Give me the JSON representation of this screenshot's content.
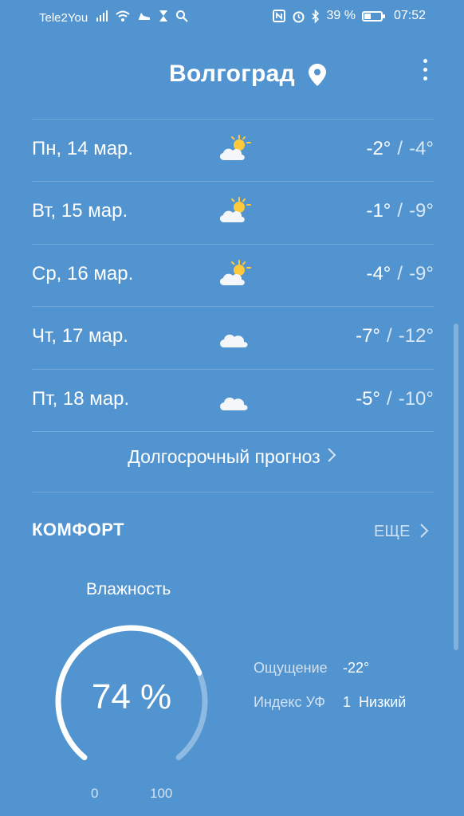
{
  "status_bar": {
    "carrier": "Tele2You",
    "battery": "39 %",
    "battery_level": 0.39,
    "time": "07:52",
    "icons": [
      "signal-icon",
      "wifi-icon",
      "shoe-icon",
      "hourglass-icon",
      "search-icon",
      "nfc-icon",
      "alarm-icon",
      "bluetooth-icon",
      "battery-icon"
    ]
  },
  "header": {
    "city": "Волгоград",
    "location_icon": "location-pin-icon",
    "menu_icon": "more-vert-icon"
  },
  "forecast": [
    {
      "day": "Пн, 14 мар.",
      "icon": "partly-sunny-icon",
      "high": "-2°",
      "low": "-4°"
    },
    {
      "day": "Вт, 15 мар.",
      "icon": "partly-sunny-icon",
      "high": "-1°",
      "low": "-9°"
    },
    {
      "day": "Ср, 16 мар.",
      "icon": "partly-sunny-icon",
      "high": "-4°",
      "low": "-9°"
    },
    {
      "day": "Чт, 17 мар.",
      "icon": "cloud-icon",
      "high": "-7°",
      "low": "-12°"
    },
    {
      "day": "Пт, 18 мар.",
      "icon": "cloud-icon",
      "high": "-5°",
      "low": "-10°"
    }
  ],
  "temp_separator": "/",
  "long_term_label": "Долгосрочный прогноз",
  "comfort": {
    "title": "КОМФОРТ",
    "more_label": "ЕЩЕ",
    "humidity_label": "Влажность",
    "humidity_value": "74 %",
    "humidity_fraction": 0.74,
    "gauge_min": "0",
    "gauge_max": "100",
    "feels_like_label": "Ощущение",
    "feels_like_value": "-22°",
    "uv_label": "Индекс УФ",
    "uv_value": "1",
    "uv_level": "Низкий"
  },
  "colors": {
    "background": "#5294cf",
    "sun": "#ffc93c",
    "cloud": "#f4f6f9"
  }
}
